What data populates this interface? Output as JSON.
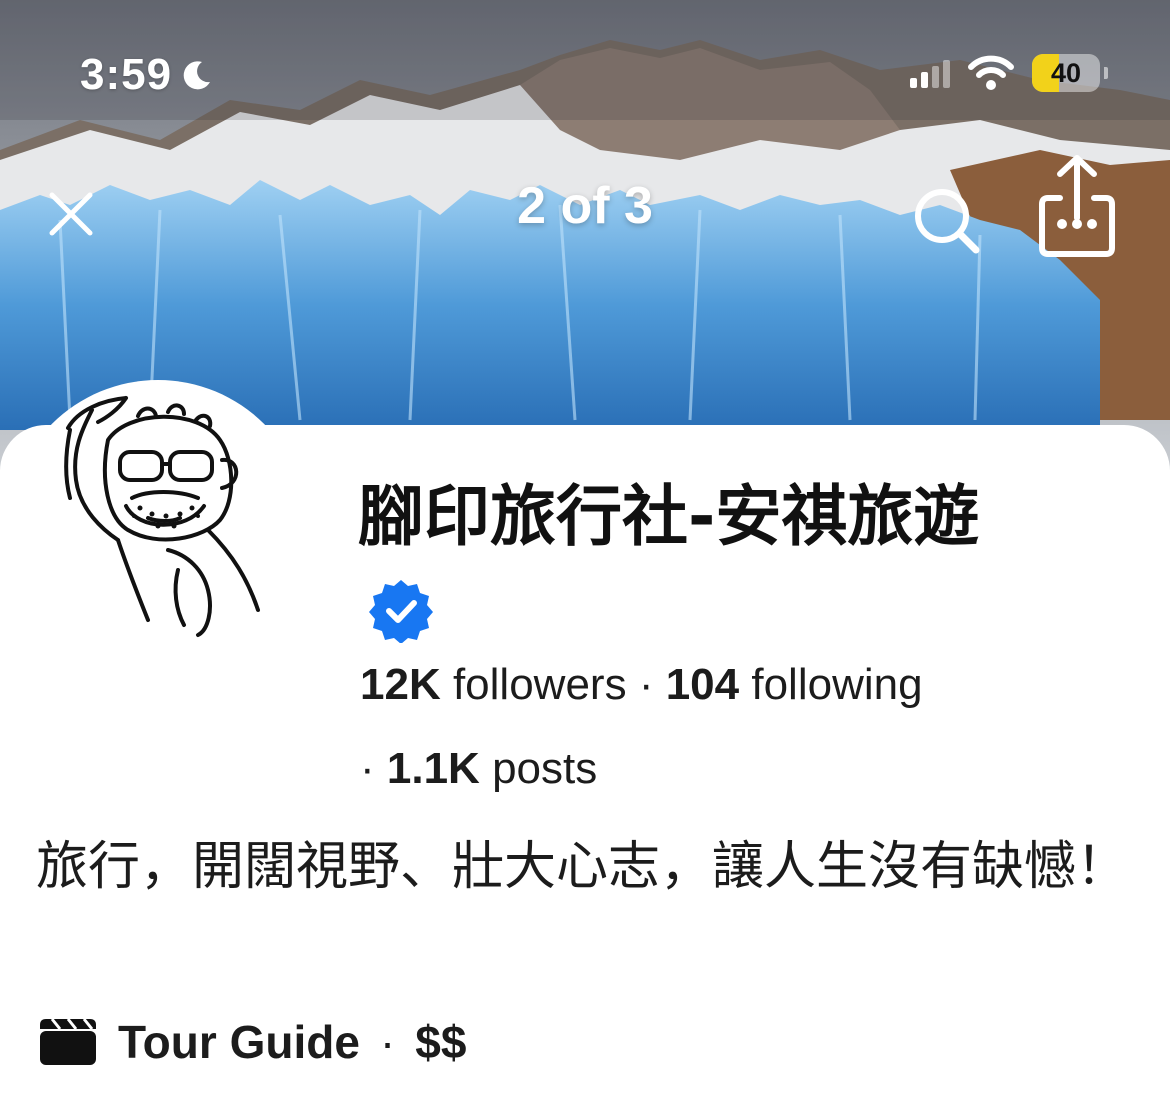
{
  "status_bar": {
    "time": "3:59",
    "battery": "40"
  },
  "nav": {
    "page_counter": "2 of 3"
  },
  "profile": {
    "name": "腳印旅行社-安祺旅遊",
    "followers_count": "12K",
    "followers_label": "followers",
    "following_count": "104",
    "following_label": "following",
    "posts_count": "1.1K",
    "posts_label": "posts",
    "separator": "·",
    "bio": "旅行，開闊視野、壯大心志，讓人生沒有缺憾！",
    "category": "Tour Guide",
    "price_range": "$$"
  },
  "colors": {
    "verified_badge": "#1877f2",
    "battery_fill": "#f2d21a"
  },
  "icons": [
    "moon-icon",
    "signal-icon",
    "wifi-icon",
    "battery-icon",
    "close-icon",
    "search-icon",
    "share-icon",
    "verified-badge-icon",
    "clapperboard-icon"
  ]
}
